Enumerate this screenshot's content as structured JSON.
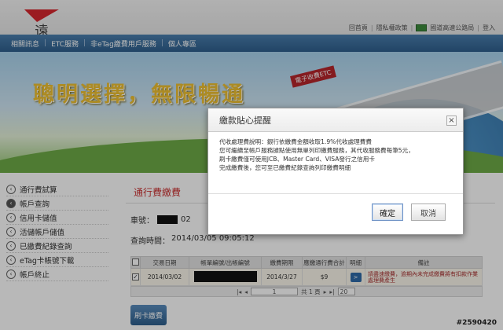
{
  "header": {
    "logo_text": "遠通電收",
    "toplinks": [
      "回首頁",
      "隱私權政策",
      "國道高速公路局",
      "登入"
    ]
  },
  "nav": {
    "items": [
      "相關訊息",
      "ETC服務",
      "非eTag繳費用戶服務",
      "個人專區"
    ]
  },
  "banner": {
    "slogan": "聰明選擇，無限暢通",
    "sign": "電子收費ETC"
  },
  "sidebar": {
    "items": [
      {
        "label": "通行費試算"
      },
      {
        "label": "帳戶查詢"
      },
      {
        "label": "信用卡儲值"
      },
      {
        "label": "活儲帳戶儲值"
      },
      {
        "label": "已繳費紀錄查詢"
      },
      {
        "label": "eTag卡帳號下載"
      },
      {
        "label": "帳戶終止"
      }
    ]
  },
  "main": {
    "section_title": "通行費繳費",
    "car_label": "車號：",
    "car_suffix": "02",
    "query_label": "查詢時間：",
    "query_time": "2014/03/05 09:05:12",
    "table": {
      "headers": [
        "",
        "交易日期",
        "帳單編號/出帳編號",
        "繳費期限",
        "應繳通行費合計",
        "明細",
        "備註"
      ],
      "rows": [
        {
          "date": "2014/03/02",
          "due": "2014/3/27",
          "amount": "$9",
          "detail": ">",
          "note": "請盡速繳費，逾期內未完成繳費將有扣款作業處理費產生"
        }
      ]
    },
    "pager": {
      "page_value": "1",
      "total": "共 1 頁",
      "per_page": "20"
    },
    "pay_button": "刷卡繳費"
  },
  "modal": {
    "title": "繳款貼心提醒",
    "close": "×",
    "lines": [
      "代收處理費說明：銀行依繳費金額收取1.9%代收處理費費",
      "您可繼續至帳戶服務據點使用無單列印繳費服務，其代收服務費每筆5元，",
      "刷卡繳費僅可使用JCB、Master Card、VISA發行之信用卡",
      "完成繳費後，您可至已繳費紀錄查詢列印繳費明細"
    ],
    "ok_label": "確定",
    "cancel_label": "取消"
  },
  "watermark": "#2590420"
}
